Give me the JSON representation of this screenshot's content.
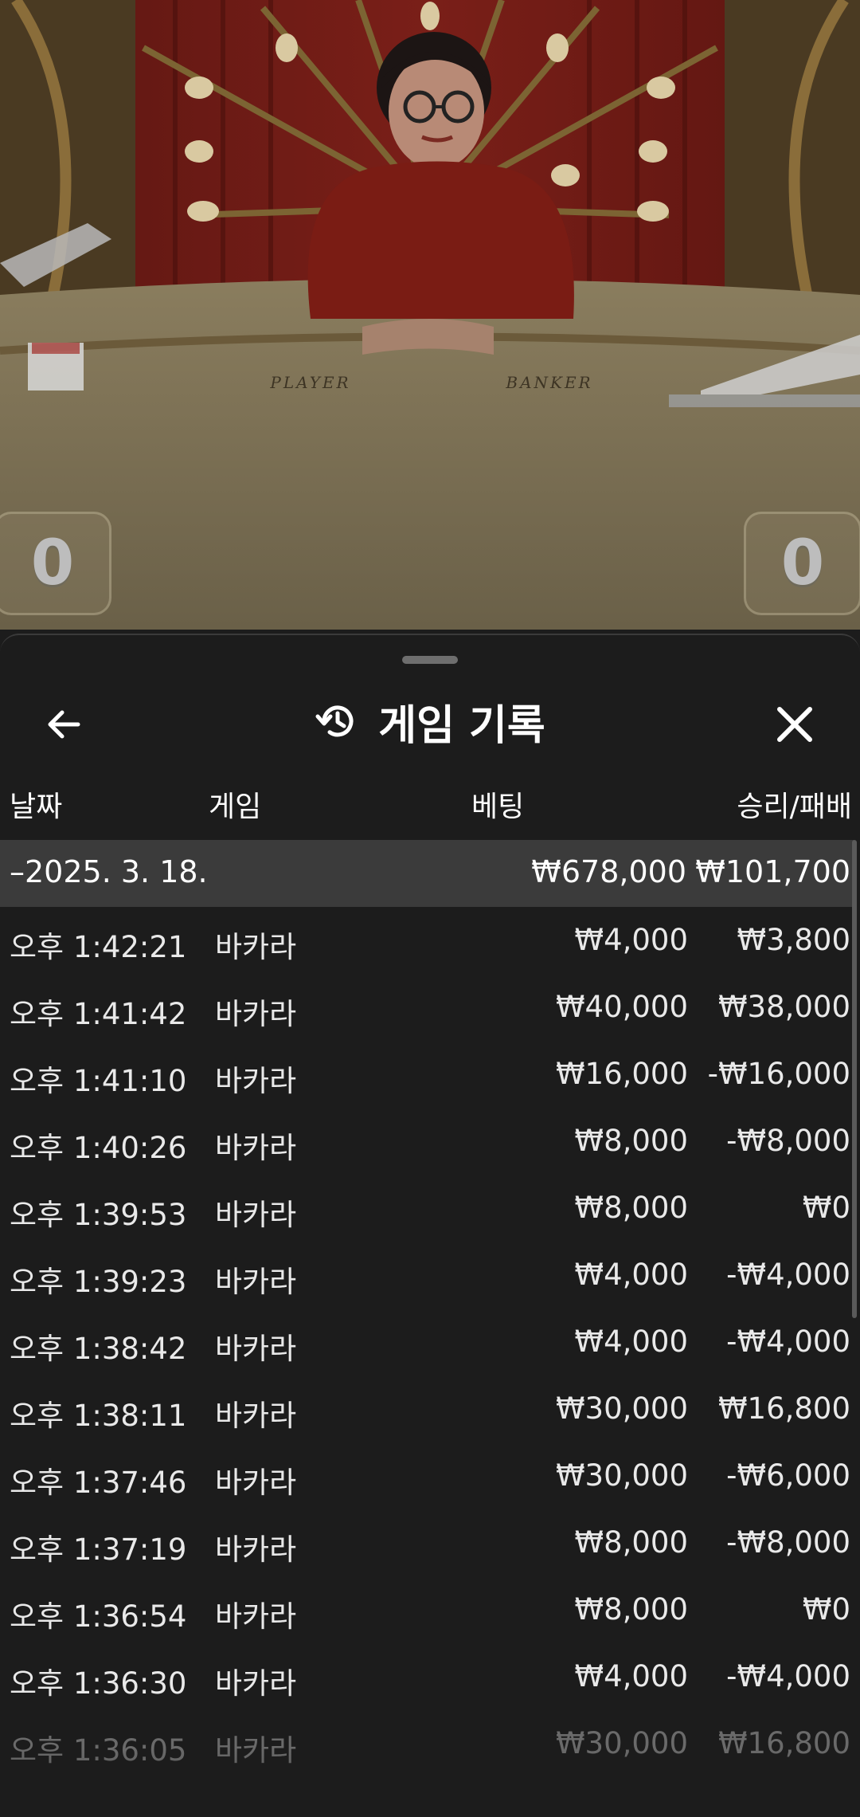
{
  "video": {
    "table_labels": {
      "player": "PLAYER",
      "banker": "BANKER"
    },
    "player_score": "0",
    "banker_score": "0"
  },
  "sheet": {
    "title": "게임 기록",
    "icons": {
      "back": "arrow-left-icon",
      "history": "history-icon",
      "close": "close-icon"
    },
    "columns": {
      "date": "날짜",
      "game": "게임",
      "bet": "베팅",
      "win_loss": "승리/패배"
    },
    "group": {
      "date": "–2025. 3. 18.",
      "total_bet": "₩678,000",
      "total_win_loss": "₩101,700"
    },
    "rows": [
      {
        "time": "오후 1:42:21",
        "game": "바카라",
        "bet": "₩4,000",
        "win_loss": "₩3,800"
      },
      {
        "time": "오후 1:41:42",
        "game": "바카라",
        "bet": "₩40,000",
        "win_loss": "₩38,000"
      },
      {
        "time": "오후 1:41:10",
        "game": "바카라",
        "bet": "₩16,000",
        "win_loss": "-₩16,000"
      },
      {
        "time": "오후 1:40:26",
        "game": "바카라",
        "bet": "₩8,000",
        "win_loss": "-₩8,000"
      },
      {
        "time": "오후 1:39:53",
        "game": "바카라",
        "bet": "₩8,000",
        "win_loss": "₩0"
      },
      {
        "time": "오후 1:39:23",
        "game": "바카라",
        "bet": "₩4,000",
        "win_loss": "-₩4,000"
      },
      {
        "time": "오후 1:38:42",
        "game": "바카라",
        "bet": "₩4,000",
        "win_loss": "-₩4,000"
      },
      {
        "time": "오후 1:38:11",
        "game": "바카라",
        "bet": "₩30,000",
        "win_loss": "₩16,800"
      },
      {
        "time": "오후 1:37:46",
        "game": "바카라",
        "bet": "₩30,000",
        "win_loss": "-₩6,000"
      },
      {
        "time": "오후 1:37:19",
        "game": "바카라",
        "bet": "₩8,000",
        "win_loss": "-₩8,000"
      },
      {
        "time": "오후 1:36:54",
        "game": "바카라",
        "bet": "₩8,000",
        "win_loss": "₩0"
      },
      {
        "time": "오후 1:36:30",
        "game": "바카라",
        "bet": "₩4,000",
        "win_loss": "-₩4,000"
      },
      {
        "time": "오후 1:36:05",
        "game": "바카라",
        "bet": "₩30,000",
        "win_loss": "₩16,800"
      }
    ]
  }
}
